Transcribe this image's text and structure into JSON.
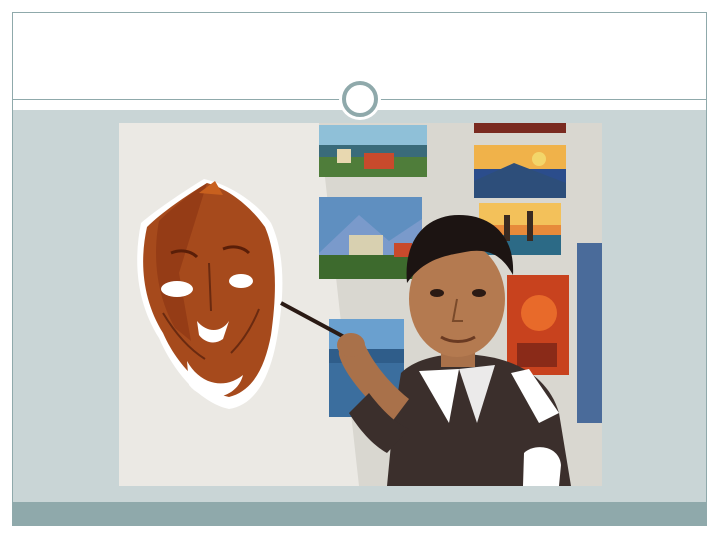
{
  "slide": {
    "title": "",
    "colors": {
      "accent": "#8fa9ab",
      "content_band": "#c9d5d6",
      "background": "#ffffff"
    }
  },
  "photo": {
    "subject": "painter-at-work"
  }
}
